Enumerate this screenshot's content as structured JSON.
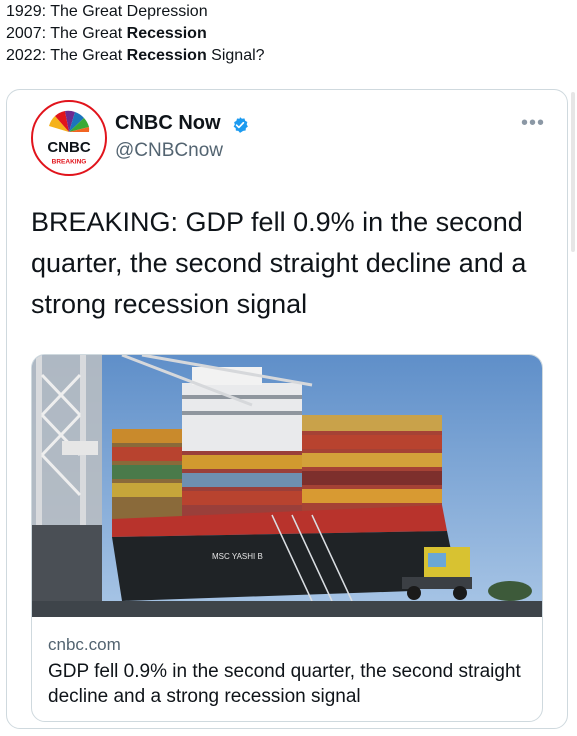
{
  "caption": {
    "line1": "1929: The Great Depression",
    "line2_prefix": "2007: The Great ",
    "line2_bold": "Recession",
    "line3_prefix": "2022: The Great ",
    "line3_bold": "Recession",
    "line3_suffix": " Signal?"
  },
  "tweet": {
    "author_name": "CNBC Now",
    "author_handle": "@CNBCnow",
    "avatar_logo_text": "CNBC",
    "avatar_badge_text": "BREAKING",
    "more_icon": "more-dots-icon",
    "verified_icon": "verified-badge-icon",
    "text": "BREAKING: GDP fell 0.9% in the second quarter, the second straight decline and a strong recession signal",
    "link_card": {
      "image_ship_label": "MSC YASHI B",
      "domain": "cnbc.com",
      "title": "GDP fell 0.9% in the second quarter, the second straight decline and a strong recession signal"
    }
  },
  "colors": {
    "verified": "#1d9bf0",
    "border": "#cfd9de",
    "secondary_text": "#536471",
    "cnbc_red": "#e1141c"
  }
}
